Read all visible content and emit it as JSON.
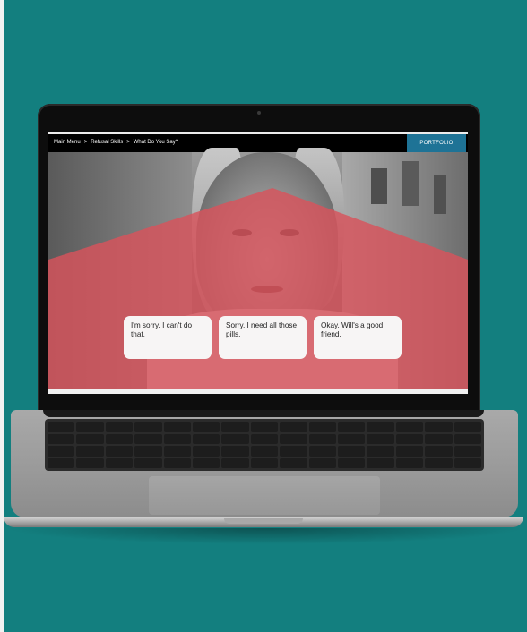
{
  "breadcrumb": {
    "items": [
      "Main Menu",
      "Refusal Skills",
      "What Do You Say?"
    ],
    "separator": ">"
  },
  "header": {
    "portfolio_label": "PORTFOLIO"
  },
  "choices": [
    {
      "label": "I'm sorry. I can't do that."
    },
    {
      "label": "Sorry. I need all those pills."
    },
    {
      "label": "Okay. Will's a good friend."
    }
  ],
  "colors": {
    "background": "#137f7f",
    "overlay": "#d8535b",
    "portfolio_bg": "#1e7396",
    "choice_bg": "#f7f5f5"
  }
}
